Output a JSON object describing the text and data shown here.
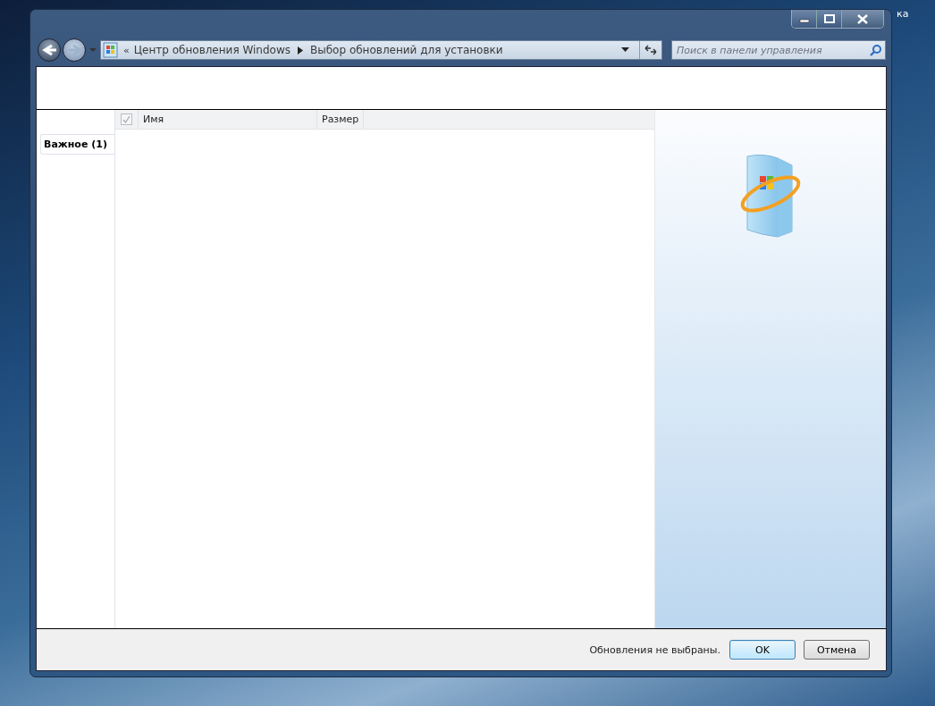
{
  "desktop": {
    "icon_label": "ка"
  },
  "nav_buttons": [
    {
      "kind": "back",
      "disabled": false
    },
    {
      "kind": "forward",
      "disabled": true
    }
  ],
  "address_bar": {
    "overflow": "«",
    "breadcrumbs": [
      "Центр обновления Windows",
      "Выбор обновлений для установки"
    ]
  },
  "search": {
    "placeholder": "Поиск в панели управления"
  },
  "categories": [
    {
      "label": "Важное (1)",
      "selected": true
    }
  ],
  "table": {
    "header_checkbox": {
      "checked": true,
      "disabled": true
    },
    "columns": [
      "Имя",
      "Размер"
    ]
  },
  "status": "Обновления не выбраны.",
  "buttons": [
    {
      "label": "OK",
      "kind": "default"
    },
    {
      "label": "Отмена",
      "kind": "normal"
    }
  ]
}
